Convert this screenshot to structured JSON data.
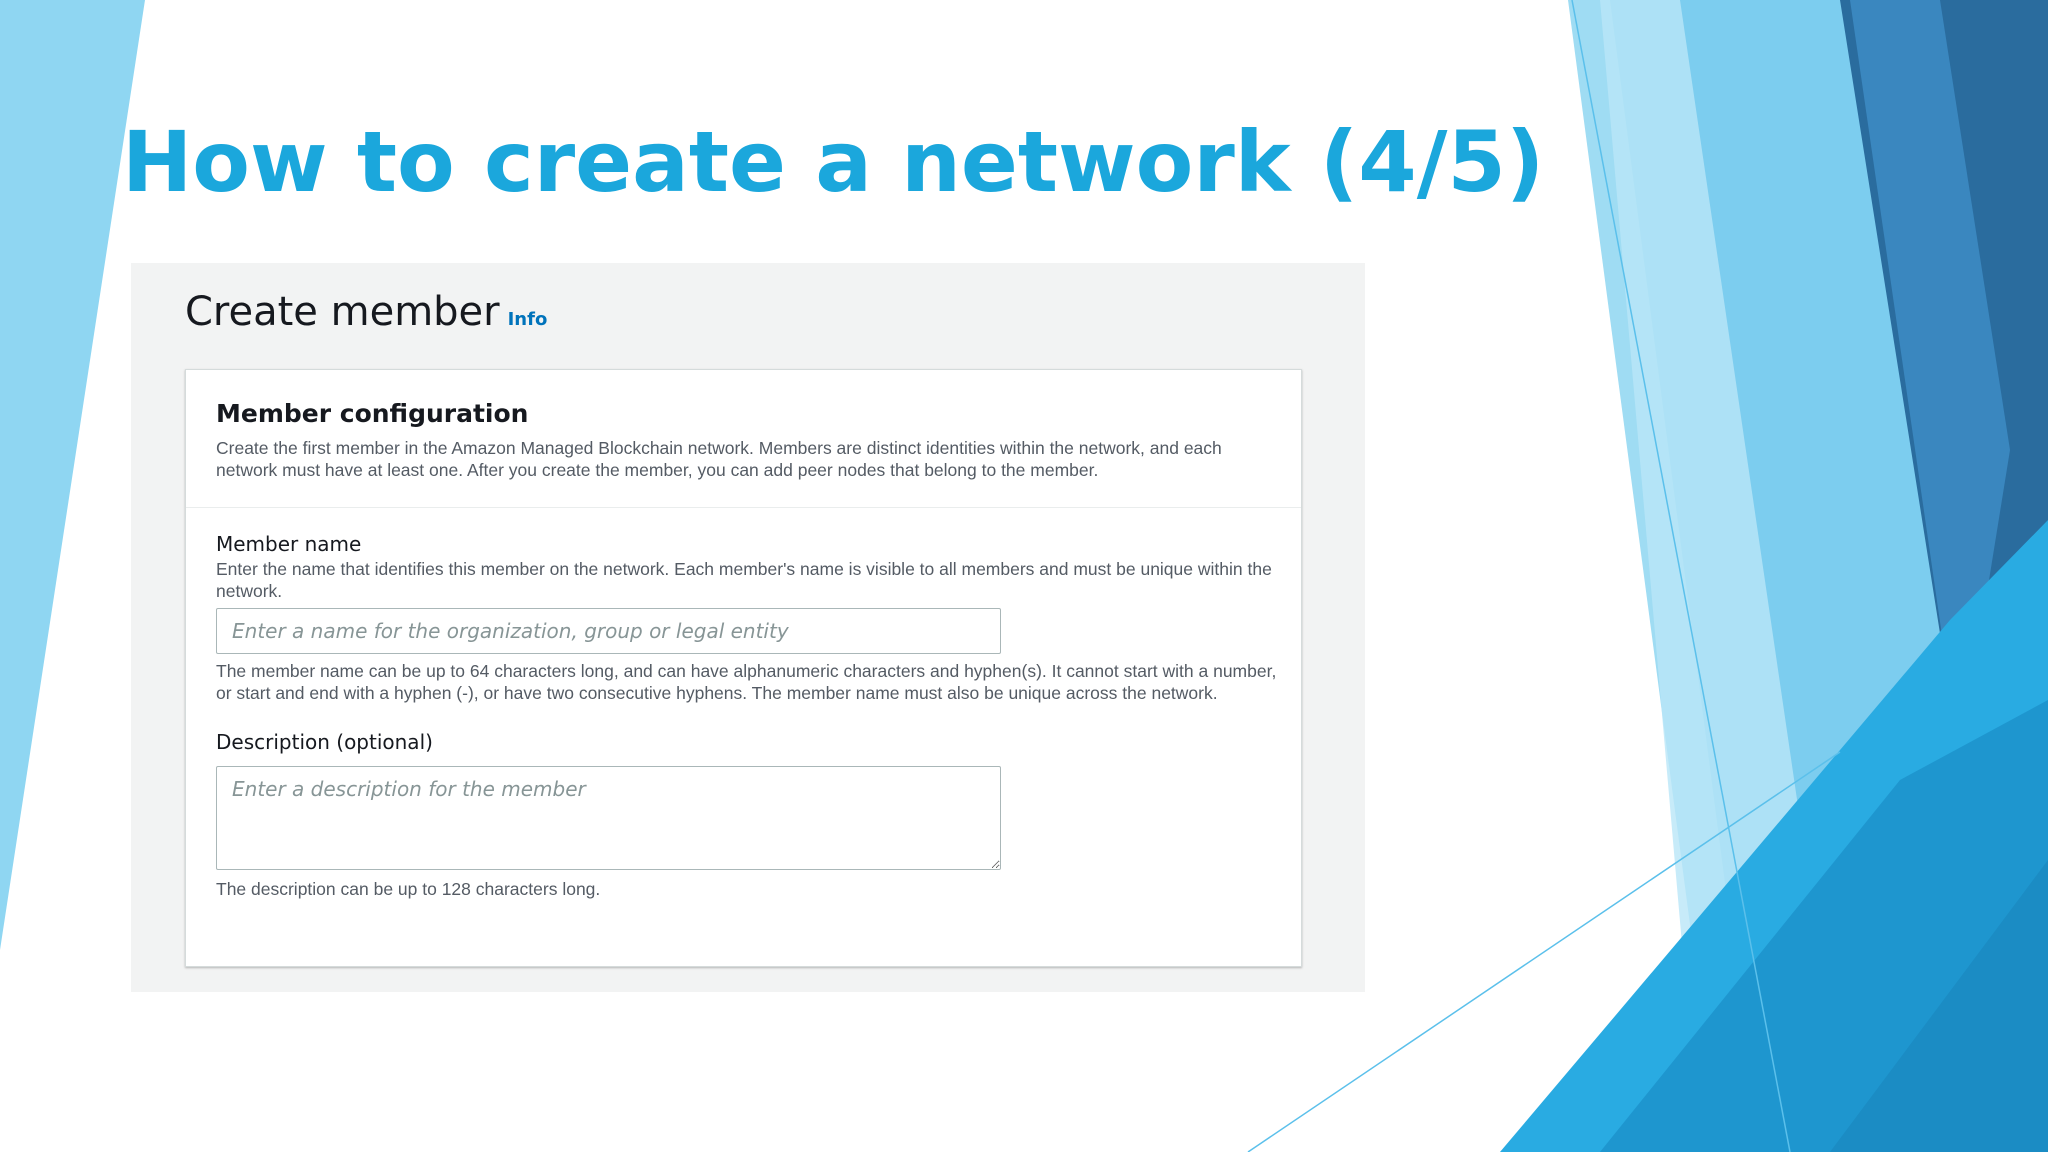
{
  "slide": {
    "title": "How to create a network (4/5)",
    "title_color": "#1ba7dc"
  },
  "page": {
    "title": "Create member",
    "info_link": "Info"
  },
  "panel": {
    "heading": "Member configuration",
    "description": "Create the first member in the Amazon Managed Blockchain network. Members are distinct identities within the network, and each network must have at least one. After you create the member, you can add peer nodes that belong to the member."
  },
  "member_name": {
    "label": "Member name",
    "description": "Enter the name that identifies this member on the network. Each member's name is visible to all members and must be unique within the network.",
    "placeholder": "Enter a name for the organization, group or legal entity",
    "value": "",
    "constraint": "The member name can be up to 64 characters long, and can have alphanumeric characters and hyphen(s). It cannot start with a number, or start and end with a hyphen (-), or have two consecutive hyphens. The member name must also be unique across the network."
  },
  "description_field": {
    "label": "Description (optional)",
    "placeholder": "Enter a description for the member",
    "value": "",
    "constraint": "The description can be up to 128 characters long."
  },
  "theme": {
    "accent": "#1ba7dc",
    "link": "#0073bb",
    "deco_light": "#8fd6f2",
    "deco_mid": "#29abe2",
    "deco_dark": "#2a6c9e"
  }
}
